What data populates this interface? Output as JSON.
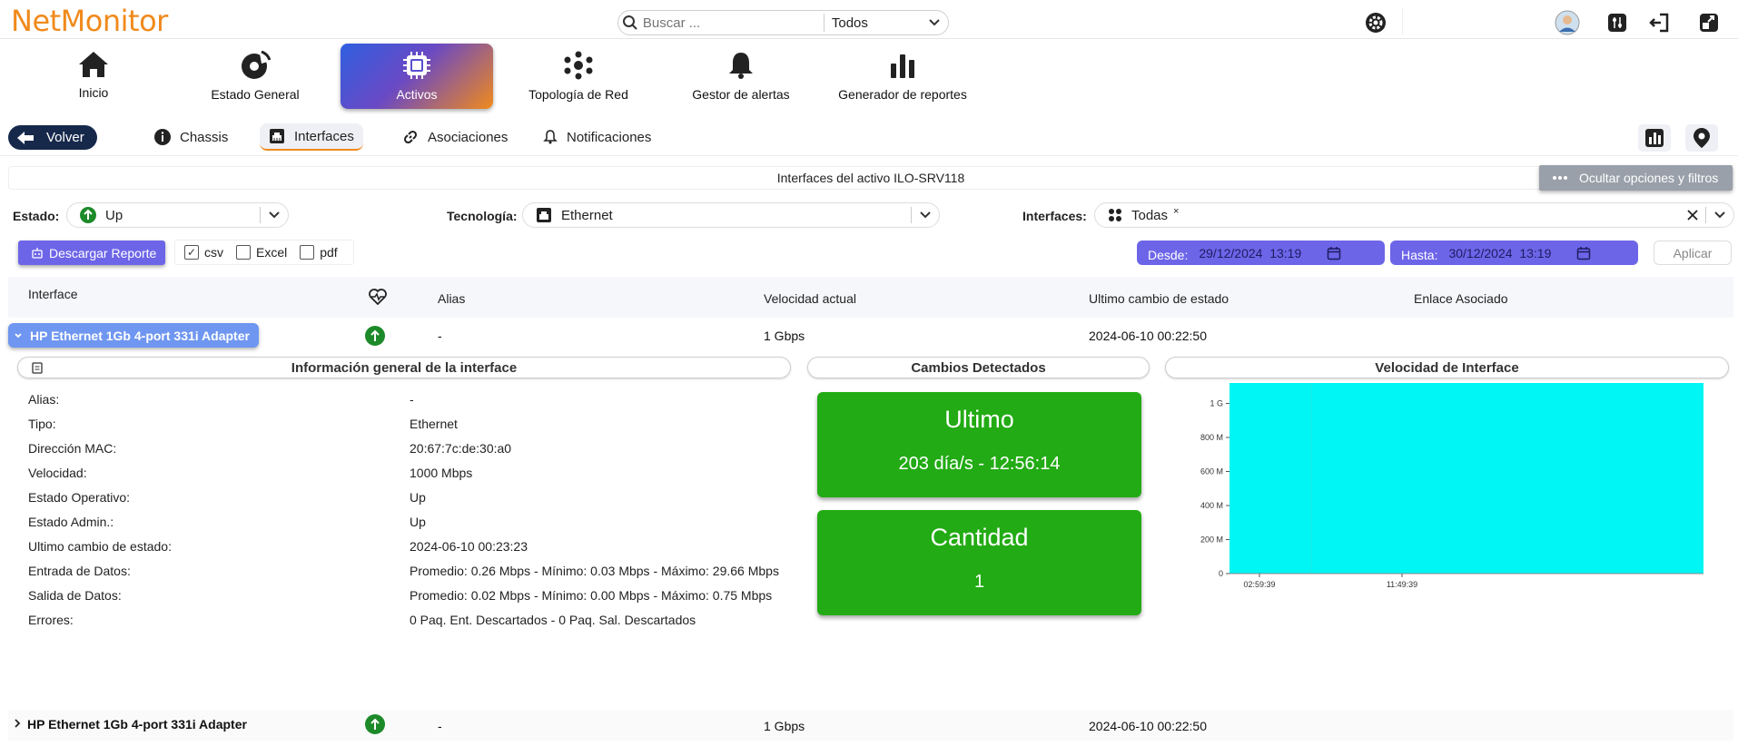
{
  "app": {
    "logo": "NetMonitor"
  },
  "search": {
    "placeholder": "Buscar ...",
    "scope": "Todos"
  },
  "nav": {
    "items": [
      {
        "label": "Inicio",
        "icon": "home-icon"
      },
      {
        "label": "Estado General",
        "icon": "gauge-icon"
      },
      {
        "label": "Activos",
        "icon": "chip-icon",
        "active": true
      },
      {
        "label": "Topología de Red",
        "icon": "network-icon"
      },
      {
        "label": "Gestor de alertas",
        "icon": "bell-icon"
      },
      {
        "label": "Generador de reportes",
        "icon": "bar-chart-icon"
      }
    ]
  },
  "subnav": {
    "back": "Volver",
    "tabs": [
      {
        "label": "Chassis",
        "icon": "info-icon"
      },
      {
        "label": "Interfaces",
        "icon": "ethernet-icon",
        "active": true
      },
      {
        "label": "Asociaciones",
        "icon": "link-icon"
      },
      {
        "label": "Notificaciones",
        "icon": "bell-icon"
      }
    ]
  },
  "page": {
    "title": "Interfaces del activo ILO-SRV118",
    "toggle_filters": "Ocultar opciones y filtros"
  },
  "filters": {
    "estado": {
      "label": "Estado:",
      "value": "Up"
    },
    "tecnologia": {
      "label": "Tecnología:",
      "value": "Ethernet"
    },
    "interfaces": {
      "label": "Interfaces:",
      "value": "Todas",
      "chip_close": "×"
    }
  },
  "actions": {
    "download": "Descargar Reporte",
    "formats": [
      {
        "label": "csv",
        "checked": true
      },
      {
        "label": "Excel",
        "checked": false
      },
      {
        "label": "pdf",
        "checked": false
      }
    ],
    "desde": {
      "label": "Desde:",
      "value": "29/12/2024  13:19"
    },
    "hasta": {
      "label": "Hasta:",
      "value": "30/12/2024  13:19"
    },
    "apply": "Aplicar"
  },
  "table": {
    "headers": {
      "interface": "Interface",
      "alias": "Alias",
      "speed": "Velocidad actual",
      "last_change": "Ultimo cambio de estado",
      "link": "Enlace Asociado"
    },
    "rows": [
      {
        "name": "HP Ethernet 1Gb 4-port 331i Adapter",
        "alias": "-",
        "speed": "1 Gbps",
        "last_change": "2024-06-10 00:22:50",
        "expanded": true
      },
      {
        "name": "HP Ethernet 1Gb 4-port 331i Adapter",
        "alias": "-",
        "speed": "1 Gbps",
        "last_change": "2024-06-10 00:22:50",
        "expanded": false
      }
    ]
  },
  "detail": {
    "info_title": "Información general de la interface",
    "changes_title": "Cambios Detectados",
    "speed_title": "Velocidad de Interface",
    "fields": [
      {
        "k": "Alias:",
        "v": "-"
      },
      {
        "k": "Tipo:",
        "v": "Ethernet"
      },
      {
        "k": "Dirección MAC:",
        "v": "20:67:7c:de:30:a0"
      },
      {
        "k": "Velocidad:",
        "v": "1000 Mbps"
      },
      {
        "k": "Estado Operativo:",
        "v": "Up"
      },
      {
        "k": "Estado Admin.:",
        "v": "Up"
      },
      {
        "k": "Ultimo cambio de estado:",
        "v": "2024-06-10 00:23:23"
      },
      {
        "k": "Entrada de Datos:",
        "v": "Promedio: 0.26 Mbps - Mínimo: 0.03 Mbps - Máximo: 29.66 Mbps"
      },
      {
        "k": "Salida de Datos:",
        "v": "Promedio: 0.02 Mbps - Mínimo: 0.00 Mbps - Máximo: 0.75 Mbps"
      },
      {
        "k": "Errores:",
        "v": "0 Paq. Ent. Descartados - 0 Paq. Sal. Descartados"
      }
    ],
    "ultimo": {
      "title": "Ultimo",
      "value": "203 día/s - 12:56:14"
    },
    "cantidad": {
      "title": "Cantidad",
      "value": "1"
    }
  },
  "colors": {
    "accent": "#f08a1c",
    "primary": "#6d65e8",
    "status_up": "#1d8a2a",
    "card_green": "#22ab14",
    "chart_fill": "#00f5f5"
  },
  "chart_data": {
    "type": "area",
    "x": [
      "02:59:39",
      "11:49:39"
    ],
    "yticks": [
      "0",
      "200 M",
      "400 M",
      "600 M",
      "800 M",
      "1 G"
    ],
    "ylim": [
      0,
      1120000000
    ],
    "series": [
      {
        "values": [
          1120000000,
          1120000000
        ]
      }
    ],
    "fill_color": "#00f5f5",
    "grid": false
  }
}
